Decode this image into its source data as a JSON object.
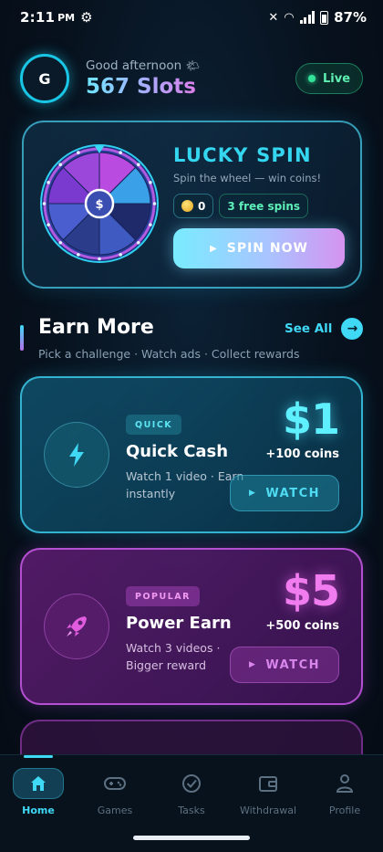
{
  "status_bar": {
    "time": "2:11",
    "ampm": "PM",
    "battery": "87%"
  },
  "header": {
    "avatar_letter": "G",
    "greeting": "Good afternoon",
    "app_name": "567 Slots",
    "live_label": "Live"
  },
  "spin_card": {
    "title": "LUCKY SPIN",
    "subtitle": "Spin the wheel — win coins!",
    "coins": "0",
    "free_spins": "3 free spins",
    "button_label": "SPIN NOW",
    "wheel_center": "$"
  },
  "earn_section": {
    "title": "Earn More",
    "subtitle": "Pick a challenge · Watch ads · Collect rewards",
    "see_all_label": "See All"
  },
  "offers": [
    {
      "tag": "QUICK",
      "name": "Quick Cash",
      "desc": "Watch 1 video · Earn instantly",
      "amount": "$1",
      "coins": "+100 coins",
      "button": "WATCH",
      "icon": "lightning-icon"
    },
    {
      "tag": "POPULAR",
      "name": "Power Earn",
      "desc": "Watch 3 videos · Bigger reward",
      "amount": "$5",
      "coins": "+500 coins",
      "button": "WATCH",
      "icon": "rocket-icon"
    }
  ],
  "bottom_nav": [
    {
      "label": "Home",
      "icon": "home-icon",
      "active": true
    },
    {
      "label": "Games",
      "icon": "gamepad-icon",
      "active": false
    },
    {
      "label": "Tasks",
      "icon": "check-circle-icon",
      "active": false
    },
    {
      "label": "Withdrawal",
      "icon": "wallet-icon",
      "active": false
    },
    {
      "label": "Profile",
      "icon": "person-icon",
      "active": false
    }
  ],
  "colors": {
    "accent_cyan": "#3fd8f5",
    "accent_purple": "#e25ce0",
    "live_green": "#34e39a",
    "background": "#07111d"
  }
}
